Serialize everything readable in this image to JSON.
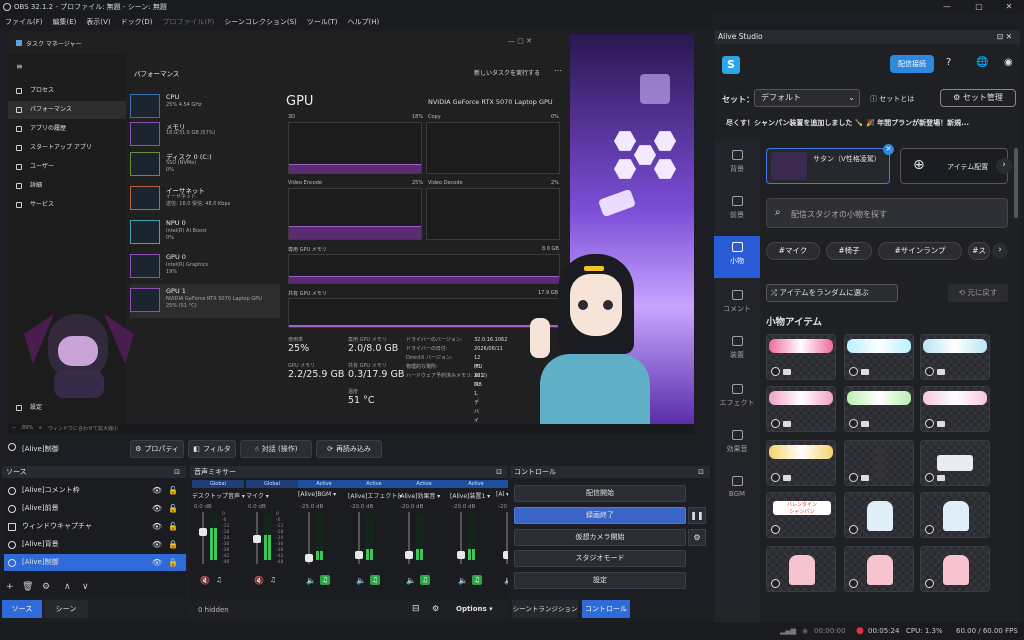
{
  "window": {
    "title": "OBS 32.1.2 - プロファイル: 無題 - シーン: 無題",
    "controls": [
      "—",
      "▢",
      "✕"
    ]
  },
  "menu": [
    "ファイル(F)",
    "編集(E)",
    "表示(V)",
    "ドック(D)",
    "プロファイル(P)",
    "シーンコレクション(S)",
    "ツール(T)",
    "ヘルプ(H)"
  ],
  "taskmanager": {
    "title": "タスク マネージャー",
    "section": "パフォーマンス",
    "run_task": "新しいタスクを実行する",
    "nav": [
      "プロセス",
      "パフォーマンス",
      "アプリの履歴",
      "スタートアップ アプリ",
      "ユーザー",
      "詳細",
      "サービス"
    ],
    "settings": "設定",
    "cards": [
      {
        "name": "CPU",
        "sub": "25% 4.54 GHz"
      },
      {
        "name": "メモリ",
        "sub": "18.0/31.5 GB (57%)"
      },
      {
        "name": "ディスク 0 (C:)",
        "sub": "SSD (NVMe)\n0%"
      },
      {
        "name": "イーサネット",
        "sub": "イーサネット\n送信: 16.0 受信: 48.0 Kbps"
      },
      {
        "name": "NPU 0",
        "sub": "Intel(R) AI Boost\n0%"
      },
      {
        "name": "GPU 0",
        "sub": "Intel(R) Graphics\n19%"
      },
      {
        "name": "GPU 1",
        "sub": "NVIDIA GeForce RTX 5070 Laptop GPU\n25% (51 °C)"
      }
    ],
    "gpu_heading": "GPU",
    "gpu_model": "NVIDIA GeForce RTX 5070 Laptop GPU",
    "graphs": [
      {
        "label": "3D",
        "pct": "18%"
      },
      {
        "label": "Copy",
        "pct": "0%"
      },
      {
        "label": "Video Encode",
        "pct": "25%"
      },
      {
        "label": "Video Decode",
        "pct": "2%"
      }
    ],
    "dedicated_label": "専用 GPU メモリ",
    "dedicated_max": "8.0 GB",
    "shared_label": "共有 GPU メモリ",
    "shared_max": "17.9 GB",
    "stats": [
      {
        "l": "使用率",
        "v": "25%"
      },
      {
        "l": "専用 GPU メモリ",
        "v": "2.0/8.0 GB"
      },
      {
        "l": "GPU メモリ",
        "v": "2.2/25.9 GB"
      },
      {
        "l": "共有 GPU メモリ",
        "v": "0.3/17.9 GB"
      },
      {
        "l": "温度",
        "v": "51 °C"
      }
    ],
    "info": [
      {
        "k": "ドライバーのバージョン:",
        "v": "32.0.16.1062"
      },
      {
        "k": "ドライバーの日付:",
        "v": "2026/06/11"
      },
      {
        "k": "DirectX バージョン:",
        "v": "12 (FL 12.2)"
      },
      {
        "k": "物理的な場所:",
        "v": "PCI バス 1, デバイ"
      },
      {
        "k": "ハードウェア予約済みメモリ:",
        "v": "301 MB"
      }
    ]
  },
  "zoom": {
    "level": "89%",
    "fit_label": "ウィンドウに合わせて拡大縮小"
  },
  "source_bar": {
    "name": "[Alive]制御",
    "props": "プロパティ",
    "filters": "フィルタ",
    "interact": "対話 (操作)",
    "reload": "再読み込み"
  },
  "sources": {
    "title": "ソース",
    "items": [
      "[Alive]コメント枠",
      "[Alive]前景",
      "ウィンドウキャプチャ",
      "[Alive]背景",
      "[Alive]制御"
    ]
  },
  "mixer": {
    "title": "音声ミキサー",
    "hidden": "0 hidden",
    "options": "Options",
    "channels": [
      {
        "tag": "Global",
        "name": "デスクトップ音声",
        "db": "0.0 dB",
        "level": 0.7
      },
      {
        "tag": "Global",
        "name": "マイク",
        "db": "0.0 dB",
        "level": 0.55
      },
      {
        "tag": "Active",
        "name": "[Alive]BGM",
        "db": "-25.0 dB",
        "level": 0.2
      },
      {
        "tag": "Active",
        "name": "[Alive]エフェクト",
        "db": "-20.0 dB",
        "level": 0.25
      },
      {
        "tag": "Active",
        "name": "[Alive]効果音",
        "db": "-20.0 dB",
        "level": 0.25
      },
      {
        "tag": "Active",
        "name": "[Alive]装置1",
        "db": "-20.0 dB",
        "level": 0.25
      },
      {
        "tag": "Active",
        "name": "[Al",
        "db": "-20",
        "level": 0.25
      }
    ],
    "scale": [
      "0",
      "-6",
      "-12",
      "-18",
      "-24",
      "-30",
      "-36",
      "-42",
      "-48"
    ]
  },
  "controls": {
    "title": "コントロール",
    "items": [
      "配信開始",
      "録画終了",
      "仮想カメラ開始",
      "スタジオモード",
      "設定"
    ],
    "tabs": [
      "シーントランジション",
      "コントロール"
    ]
  },
  "bottom_tabs": [
    "ソース",
    "シーン"
  ],
  "status": {
    "rec_idle": "00:00:00",
    "rec_time": "00:05:24",
    "cpu": "CPU: 1.3%",
    "fps": "60.00 / 60.00 FPS"
  },
  "alive": {
    "title": "Alive Studio",
    "connect": "配信接続",
    "set_label": "セット：",
    "set_value": "デフォルト",
    "set_help": "セットとは",
    "set_manage": "セット管理",
    "ticker": "尽くす！シャンパン装置を追加しました 🍾      🎉 年間プランが新登場！新規...",
    "nav": [
      "背景",
      "前景",
      "小物",
      "コメント",
      "装置",
      "エフェクト",
      "効果音",
      "BGM"
    ],
    "selected_item": "サタン（V性格凌駕）",
    "add_item": "アイテム配置",
    "search_placeholder": "配信スタジオの小物を探す",
    "tags": [
      "#マイク",
      "#椅子",
      "#サインランプ",
      "#ス"
    ],
    "random": "アイテムをランダムに選ぶ",
    "undo": "元に戻す",
    "section": "小物アイテム",
    "valentine": "バレンタイン\nシャンパン"
  }
}
